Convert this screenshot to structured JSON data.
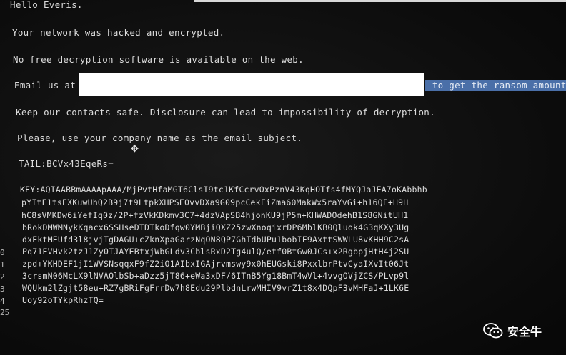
{
  "message": {
    "greeting": "Hello Everis.",
    "hacked": "Your network was hacked and encrypted.",
    "no_free": "No free decryption software is available on the web.",
    "email_prefix": "Email us at",
    "email_suffix": " to get the ransom amount.",
    "keep_safe": "Keep our contacts safe. Disclosure can lead to impossibility of decryption.",
    "subject": "Please, use your company name as the email subject.",
    "tail": "TAIL:BCVx43EqeRs=",
    "key_lines": [
      "KEY:AQIAABBmAAAApAAA/MjPvtHfaMGT6ClsI9tc1KfCcrvOxPznV43KqHOTfs4fMYQJaJEA7oKAbbhb",
      "pYItF1tsEXKuwUhQ2B9j7t9LtpkXHPSE0vvDXa9G09pcCekFiZma60MakWx5raYvGi+h16QF+H9H",
      "hC8sVMKDw6iYefIq0z/2P+fzVkKDkmv3C7+4dzVApSB4hjonKU9jP5m+KHWADOdehB1S8GNitUH1",
      "bRokDMWMNykKqacx6SSHseDTDTkoDfqw0YMBjiQXZ25zwXnoqixrDP6MblKB0Qluok4G3qKXy3Ug",
      "dxEktMEUfd3l8jvjTgDAGU+cZknXpaGarzNqON8QP7GhTdbUPu1bobIF9AxttSWWLU8vKHH9C2sA",
      "Pq71EVHvk2tzJ1Zy0TJAYEBtxjWbGLdv3CblsRxD2Tg4ulQ/etf0BtGw0JCs+x2RgbpjHtH4j2SU",
      "zpd+YKHDEF1jI1WVSNsqqxF9fZ2iO1AIbxIGAjrvmswy9x0hEUGski8PxxlbrPtvCyaIXvIt06Jt",
      "3crsmN06McLX9lNVAOlbSb+aDzz5jT86+eWa3xDF/6ITnB5Yg18BmT4wVl+4vvgOVjZCS/PLvp9l",
      "WQUkm2lZgjt58eu+RZ7gBRiFgFrrDw7h8Edu29PlbdnLrwMHIV9vrZ1t8x4DQpF3vMHFaJ+1LK6E",
      "Uoy92oTYkpRhzTQ="
    ],
    "line_numbers": [
      "0",
      "1",
      "2",
      "3",
      "4",
      "25"
    ]
  },
  "watermark": {
    "text": "安全牛",
    "icon": "wechat-icon"
  },
  "colors": {
    "background": "#0d0d0d",
    "text": "#dcdcdc",
    "highlight": "#4a6fa8",
    "redaction": "#ffffff"
  }
}
